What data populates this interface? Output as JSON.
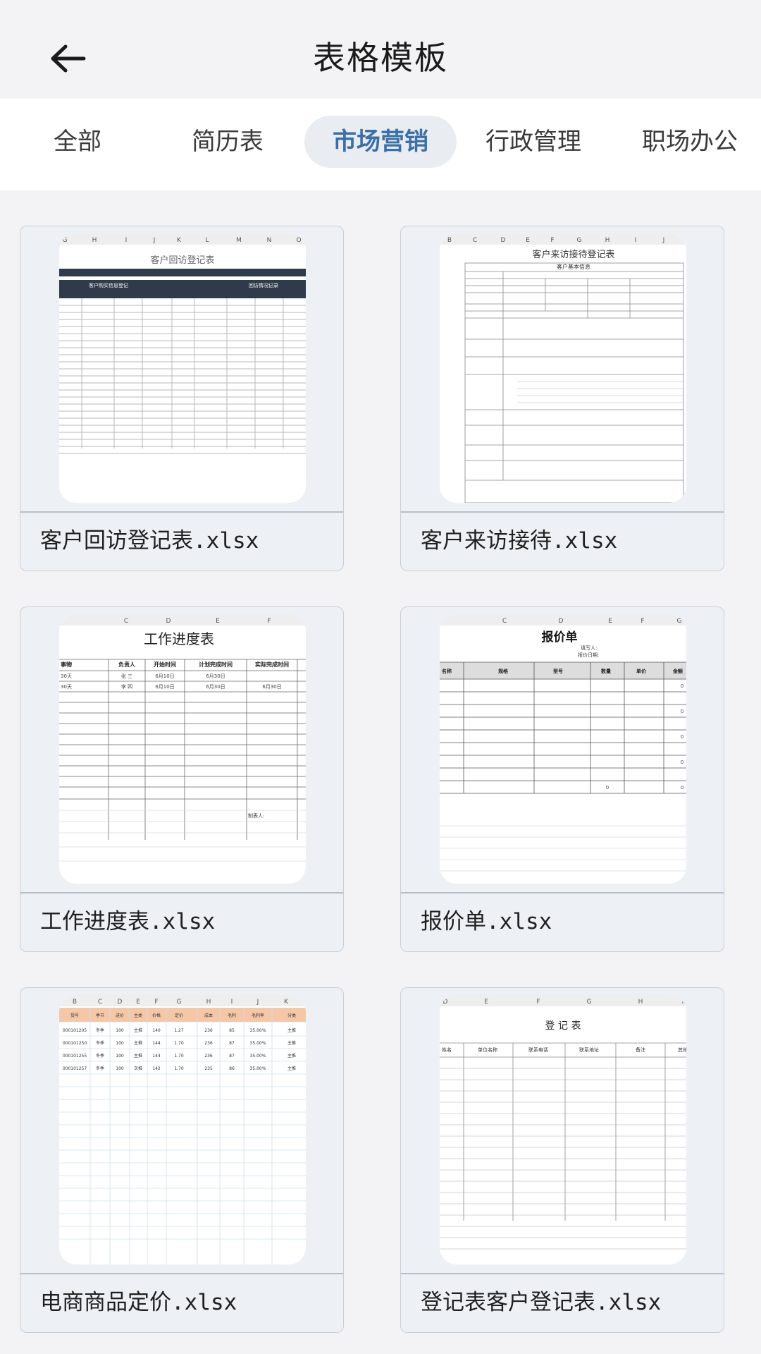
{
  "header": {
    "title": "表格模板",
    "back_icon": "arrow-left-icon"
  },
  "tabs": [
    {
      "label": "全部",
      "active": false
    },
    {
      "label": "简历表",
      "active": false
    },
    {
      "label": "市场营销",
      "active": true
    },
    {
      "label": "行政管理",
      "active": false
    },
    {
      "label": "职场办公",
      "active": false
    }
  ],
  "colors": {
    "active_tab_text": "#3a6fa8",
    "active_tab_bg": "#e9edf2",
    "card_bg": "#edf1f6",
    "dark_header": "#2f3a4a",
    "orange_header": "#f6c7a6"
  },
  "templates": [
    {
      "filename": "客户回访登记表.xlsx",
      "preview": {
        "col_letters": [
          "G",
          "H",
          "I",
          "J",
          "K",
          "L",
          "M",
          "N",
          "O"
        ],
        "title": "客户回访登记表",
        "header_left": "客户购买信息登记",
        "header_right": "回访情况记录"
      }
    },
    {
      "filename": "客户来访接待.xlsx",
      "preview": {
        "col_letters": [
          "B",
          "C",
          "D",
          "E",
          "F",
          "G",
          "H",
          "I",
          "J"
        ],
        "title": "客户来访接待登记表",
        "section": "客户基本信息"
      }
    },
    {
      "filename": "工作进度表.xlsx",
      "preview": {
        "col_letters": [
          "C",
          "D",
          "E",
          "F"
        ],
        "title": "工作进度表",
        "columns": [
          "事物",
          "负责人",
          "开始时间",
          "计划完成时间",
          "实际完成时间"
        ],
        "rows": [
          [
            "30天",
            "张 三",
            "6月10日",
            "6月30日",
            ""
          ],
          [
            "30天",
            "李 四",
            "6月10日",
            "6月30日",
            "6月30日"
          ]
        ],
        "footer": "制表人:"
      }
    },
    {
      "filename": "报价单.xlsx",
      "preview": {
        "col_letters": [
          "C",
          "D",
          "E",
          "F",
          "G"
        ],
        "title": "报价单",
        "sub_lines": [
          "填写人:",
          "报价日期:"
        ],
        "columns": [
          "名称",
          "规格",
          "型号",
          "数量",
          "单价",
          "金额"
        ],
        "zero": "0"
      }
    },
    {
      "filename": "电商商品定价.xlsx",
      "preview": {
        "col_letters": [
          "B",
          "C",
          "D",
          "E",
          "F",
          "G",
          "H",
          "I",
          "J",
          "K"
        ],
        "columns": [
          "货号",
          "季节",
          "进价",
          "主类",
          "价格",
          "定价",
          "成本",
          "毛利",
          "毛利率",
          "分类"
        ],
        "rows": [
          [
            "000101205",
            "冬季",
            "100",
            "主推",
            "140",
            "1.27",
            "236",
            "85",
            "35.00%",
            "主推"
          ],
          [
            "000101250",
            "冬季",
            "100",
            "主推",
            "144",
            "1.70",
            "236",
            "87",
            "35.00%",
            "主推"
          ],
          [
            "000101255",
            "冬季",
            "100",
            "主推",
            "144",
            "1.70",
            "236",
            "87",
            "35.00%",
            "主推"
          ],
          [
            "000101257",
            "冬季",
            "100",
            "次推",
            "142",
            "1.70",
            "235",
            "86",
            "35.00%",
            "主推"
          ]
        ]
      }
    },
    {
      "filename": "登记表客户登记表.xlsx",
      "preview": {
        "col_letters": [
          "D",
          "E",
          "F",
          "G",
          "H",
          "I"
        ],
        "title": "登 记 表",
        "columns": [
          "姓名",
          "单位名称",
          "联系电话",
          "联系地址",
          "备注",
          "其他"
        ]
      }
    }
  ]
}
